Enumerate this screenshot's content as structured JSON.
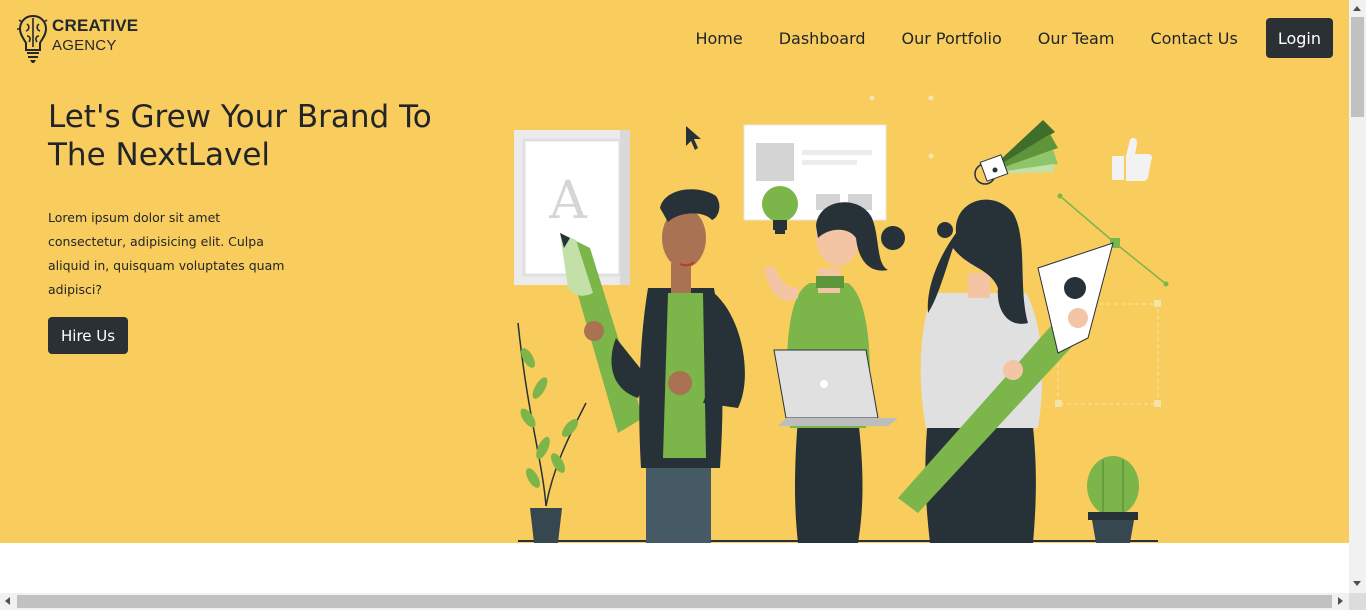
{
  "brand": {
    "line1": "CREATIVE",
    "line2": "AGENCY",
    "icon": "brain-lightbulb-icon"
  },
  "nav": {
    "items": [
      {
        "label": "Home"
      },
      {
        "label": "Dashboard"
      },
      {
        "label": "Our Portfolio"
      },
      {
        "label": "Our Team"
      },
      {
        "label": "Contact Us"
      }
    ],
    "login_label": "Login"
  },
  "hero": {
    "headline": "Let's Grew Your Brand To The NextLavel",
    "body": "Lorem ipsum dolor sit amet consectetur, adipisicing elit. Culpa aliquid in, quisquam voluptates quam adipisci?",
    "cta_label": "Hire Us",
    "illustration_letter": "A"
  },
  "colors": {
    "hero_bg": "#f9cd5d",
    "button_dark": "#2b3035",
    "accent_green": "#7cb54a",
    "dark_navy": "#263238"
  }
}
